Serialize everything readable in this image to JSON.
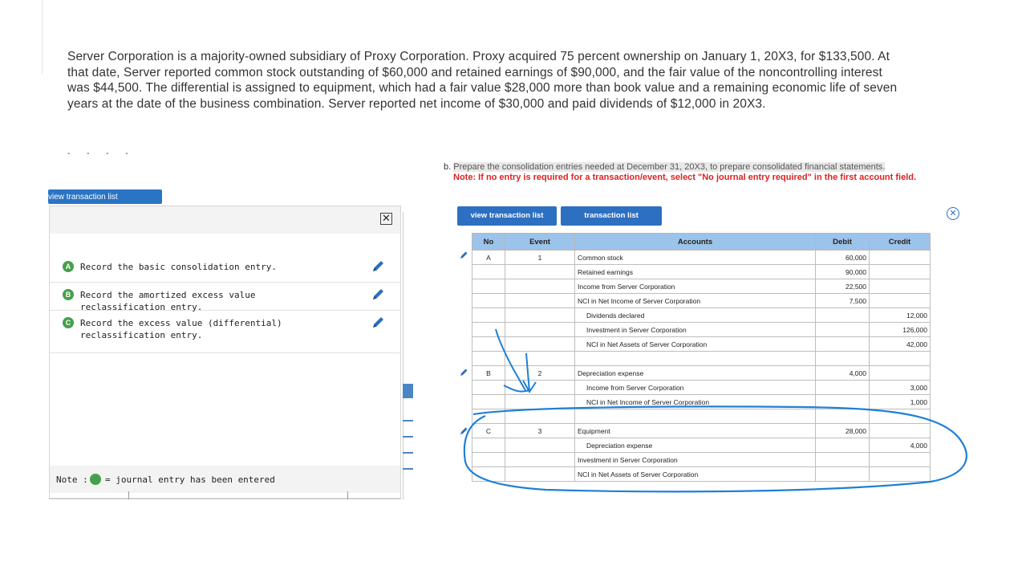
{
  "problem": {
    "paragraph": "Server Corporation is a majority-owned subsidiary of Proxy Corporation. Proxy acquired 75 percent ownership on January 1, 20X3, for $133,500. At that date, Server reported common stock outstanding of $60,000 and retained earnings of $90,000, and the fair value of the noncontrolling interest was $44,500. The differential is assigned to equipment, which had a fair value $28,000 more than book value and a remaining economic life of seven years at the date of the business combination. Server reported net income of $30,000 and paid dividends of $12,000 in 20X3."
  },
  "left_panel": {
    "tab_label": "view transaction list",
    "close_symbol": "✕",
    "items": [
      {
        "badge": "A",
        "label": "Record the basic consolidation entry."
      },
      {
        "badge": "B",
        "label": "Record the amortized excess value reclassification entry."
      },
      {
        "badge": "C",
        "label": "Record the excess value (differential) reclassification entry."
      }
    ],
    "note_prefix": "Note :",
    "note_suffix": "= journal entry has been entered"
  },
  "instructions": {
    "prefix": "b.",
    "main": "Prepare the consolidation entries needed at December 31, 20X3, to prepare consolidated financial statements.",
    "note": "Note: If no entry is required for a transaction/event, select \"No journal entry required\" in the first account field."
  },
  "tabs": {
    "view_transaction_list": "view transaction list",
    "transaction_list": "transaction list"
  },
  "journal": {
    "headers": {
      "no": "No",
      "event": "Event",
      "accounts": "Accounts",
      "debit": "Debit",
      "credit": "Credit"
    },
    "rows": [
      {
        "no": "A",
        "event": "1",
        "account": "Common stock",
        "indent": false,
        "debit": "60,000",
        "credit": ""
      },
      {
        "no": "",
        "event": "",
        "account": "Retained earnings",
        "indent": false,
        "debit": "90,000",
        "credit": ""
      },
      {
        "no": "",
        "event": "",
        "account": "Income from Server Corporation",
        "indent": false,
        "debit": "22,500",
        "credit": ""
      },
      {
        "no": "",
        "event": "",
        "account": "NCI in Net Income of Server Corporation",
        "indent": false,
        "debit": "7,500",
        "credit": ""
      },
      {
        "no": "",
        "event": "",
        "account": "Dividends declared",
        "indent": true,
        "debit": "",
        "credit": "12,000"
      },
      {
        "no": "",
        "event": "",
        "account": "Investment in Server Corporation",
        "indent": true,
        "debit": "",
        "credit": "126,000"
      },
      {
        "no": "",
        "event": "",
        "account": "NCI in Net Assets of Server Corporation",
        "indent": true,
        "debit": "",
        "credit": "42,000"
      },
      {
        "no": "",
        "event": "",
        "account": "",
        "indent": false,
        "debit": "",
        "credit": ""
      },
      {
        "no": "B",
        "event": "2",
        "account": "Depreciation expense",
        "indent": false,
        "debit": "4,000",
        "credit": ""
      },
      {
        "no": "",
        "event": "",
        "account": "Income from Server Corporation",
        "indent": true,
        "debit": "",
        "credit": "3,000"
      },
      {
        "no": "",
        "event": "",
        "account": "NCI in Net Income of Server Corporation",
        "indent": true,
        "debit": "",
        "credit": "1,000"
      },
      {
        "no": "",
        "event": "",
        "account": "",
        "indent": false,
        "debit": "",
        "credit": ""
      },
      {
        "no": "C",
        "event": "3",
        "account": "Equipment",
        "indent": false,
        "debit": "28,000",
        "credit": ""
      },
      {
        "no": "",
        "event": "",
        "account": "Depreciation expense",
        "indent": true,
        "debit": "",
        "credit": "4,000"
      },
      {
        "no": "",
        "event": "",
        "account": "Investment in Server Corporation",
        "indent": false,
        "debit": "",
        "credit": ""
      },
      {
        "no": "",
        "event": "",
        "account": "NCI in Net Assets of Server Corporation",
        "indent": false,
        "debit": "",
        "credit": ""
      }
    ]
  },
  "colors": {
    "accent": "#2d6fc0",
    "header": "#9cc3ea",
    "entered": "#46a04a",
    "annotation": "#1f7fd6"
  }
}
